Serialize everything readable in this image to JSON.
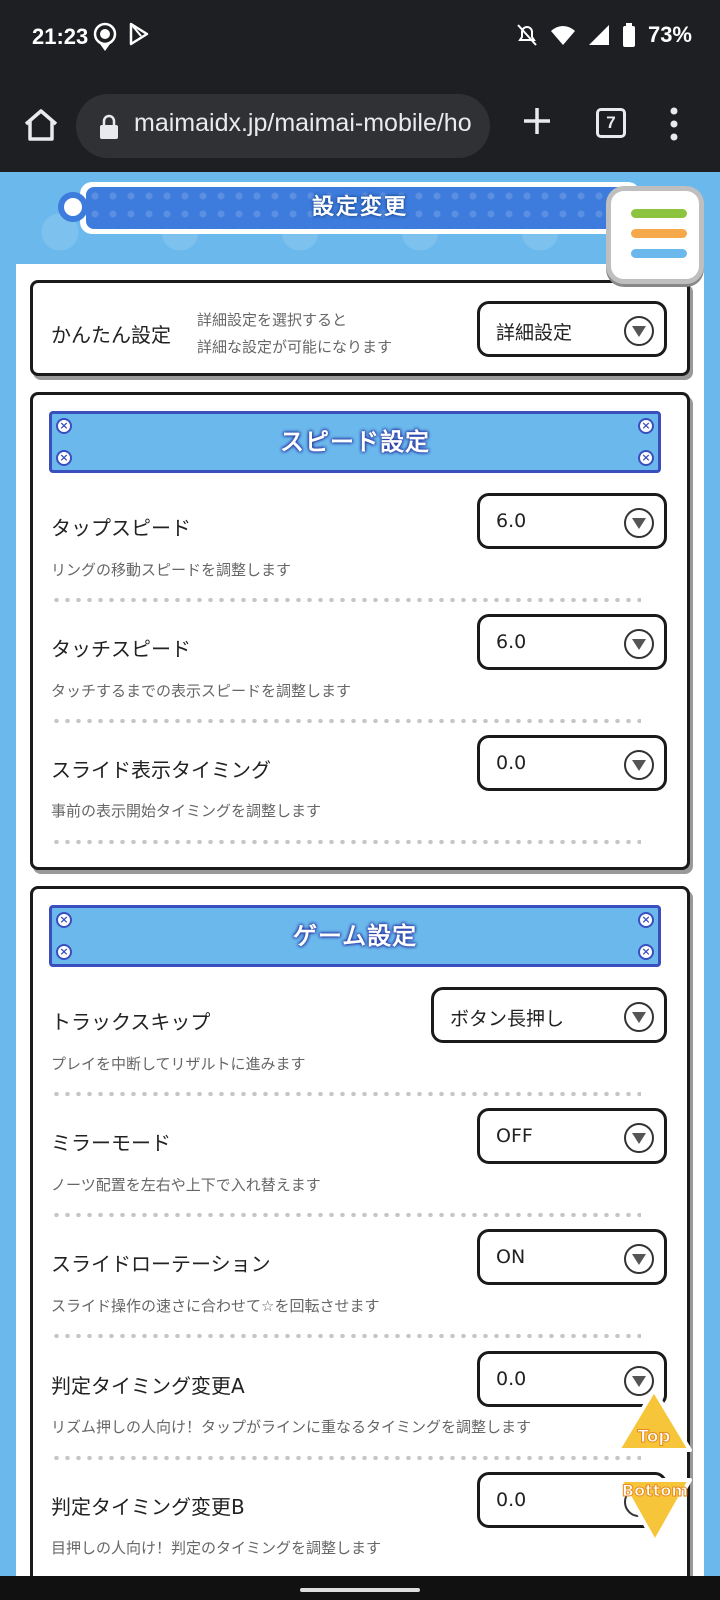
{
  "status_bar": {
    "time": "21:23",
    "battery": "73%"
  },
  "browser": {
    "url": "maimaidx.jp/maimai-mobile/ho",
    "tab_count": "7"
  },
  "page_title": "設定変更",
  "easy_setting": {
    "label": "かんたん設定",
    "desc_line1": "詳細設定を選択すると",
    "desc_line2": "詳細な設定が可能になります",
    "value": "詳細設定"
  },
  "speed_section": {
    "title": "スピード設定",
    "rows": [
      {
        "label": "タップスピード",
        "desc": "リングの移動スピードを調整します",
        "value": "6.0"
      },
      {
        "label": "タッチスピード",
        "desc": "タッチするまでの表示スピードを調整します",
        "value": "6.0"
      },
      {
        "label": "スライド表示タイミング",
        "desc": "事前の表示開始タイミングを調整します",
        "value": "0.0"
      }
    ]
  },
  "game_section": {
    "title": "ゲーム設定",
    "rows": [
      {
        "label": "トラックスキップ",
        "desc": "プレイを中断してリザルトに進みます",
        "value": "ボタン長押し"
      },
      {
        "label": "ミラーモード",
        "desc": "ノーツ配置を左右や上下で入れ替えます",
        "value": "OFF"
      },
      {
        "label": "スライドローテーション",
        "desc": "スライド操作の速さに合わせて☆を回転させます",
        "value": "ON"
      },
      {
        "label": "判定タイミング変更A",
        "desc": "リズム押しの人向け！タップがラインに重なるタイミングを調整します",
        "value": "0.0"
      },
      {
        "label": "判定タイミング変更B",
        "desc": "目押しの人向け！判定のタイミングを調整します",
        "value": "0.0"
      }
    ]
  },
  "fab": {
    "top": "Top",
    "bottom": "Bottom"
  },
  "colors": {
    "accent_blue": "#6bb8ec",
    "header_border": "#3a4fbe",
    "menu_green": "#8cc43f",
    "menu_orange": "#f6a94a",
    "menu_blue": "#6bb8ec",
    "fab_yellow": "#f7c53a"
  }
}
